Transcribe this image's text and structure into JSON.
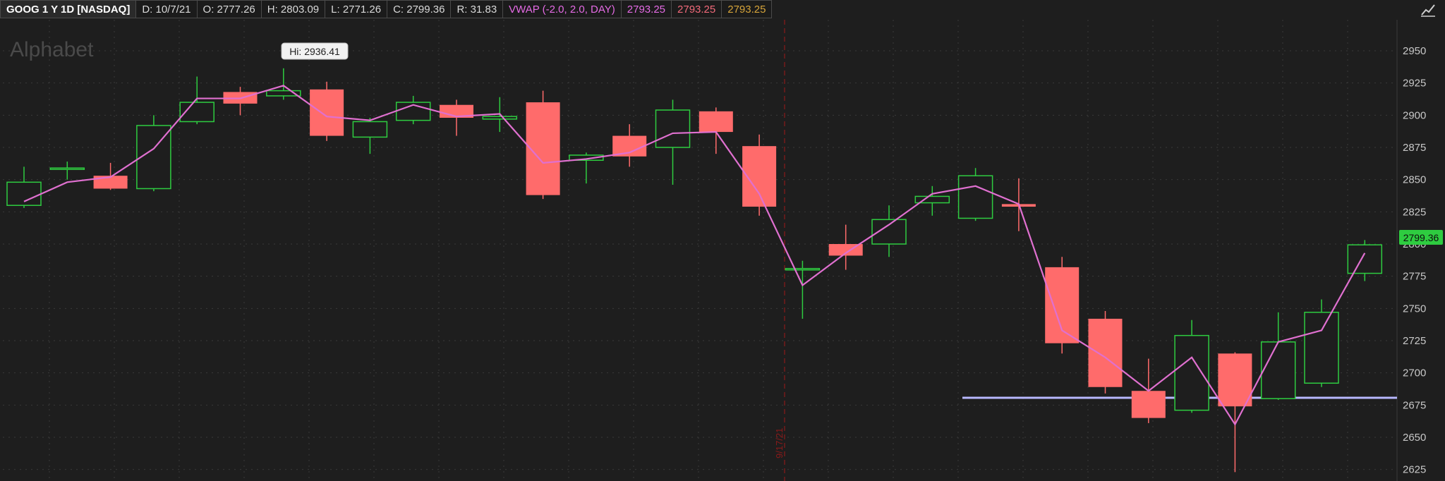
{
  "header": {
    "symbol": "GOOG 1 Y 1D [NASDAQ]",
    "date": "D: 10/7/21",
    "open": "O: 2777.26",
    "high": "H: 2803.09",
    "low": "L: 2771.26",
    "close": "C: 2799.36",
    "range": "R: 31.83",
    "vwap_label": "VWAP (-2.0, 2.0, DAY)",
    "vwap_values": [
      "2793.25",
      "2793.25",
      "2793.25"
    ]
  },
  "watermark": "Alphabet",
  "hi_label": "Hi: 2936.41",
  "date_marker": "9/17/21",
  "last_price": "2799.36",
  "colors": {
    "background": "#1e1e1e",
    "up": "#2ecc40",
    "down": "#ff6b6b",
    "vwap": "#e070d0",
    "support": "#b8b8ff",
    "last_price_bg": "#2ecc40"
  },
  "chart_data": {
    "type": "candlestick",
    "y_ticks": [
      2625,
      2650,
      2675,
      2700,
      2725,
      2750,
      2775,
      2800,
      2825,
      2850,
      2875,
      2900,
      2925,
      2950
    ],
    "ylim": [
      2615,
      2970
    ],
    "candles": [
      {
        "o": 2830,
        "h": 2860,
        "l": 2828,
        "c": 2848
      },
      {
        "o": 2858,
        "h": 2864,
        "l": 2850,
        "c": 2859
      },
      {
        "o": 2853,
        "h": 2863,
        "l": 2842,
        "c": 2843
      },
      {
        "o": 2843,
        "h": 2900,
        "l": 2841,
        "c": 2892
      },
      {
        "o": 2895,
        "h": 2930,
        "l": 2893,
        "c": 2910
      },
      {
        "o": 2918,
        "h": 2922,
        "l": 2900,
        "c": 2909
      },
      {
        "o": 2915,
        "h": 2936.41,
        "l": 2912,
        "c": 2919
      },
      {
        "o": 2920,
        "h": 2926,
        "l": 2880,
        "c": 2884
      },
      {
        "o": 2883,
        "h": 2898,
        "l": 2870,
        "c": 2895
      },
      {
        "o": 2896,
        "h": 2915,
        "l": 2893,
        "c": 2910
      },
      {
        "o": 2908,
        "h": 2912,
        "l": 2884,
        "c": 2898
      },
      {
        "o": 2897,
        "h": 2914,
        "l": 2887,
        "c": 2899
      },
      {
        "o": 2910,
        "h": 2919,
        "l": 2835,
        "c": 2838
      },
      {
        "o": 2865,
        "h": 2871,
        "l": 2847,
        "c": 2869
      },
      {
        "o": 2884,
        "h": 2893,
        "l": 2860,
        "c": 2868
      },
      {
        "o": 2875,
        "h": 2912,
        "l": 2846,
        "c": 2904
      },
      {
        "o": 2903,
        "h": 2906,
        "l": 2870,
        "c": 2887
      },
      {
        "o": 2876,
        "h": 2885,
        "l": 2822,
        "c": 2829
      },
      {
        "o": 2780,
        "h": 2787,
        "l": 2742,
        "c": 2781
      },
      {
        "o": 2800,
        "h": 2815,
        "l": 2780,
        "c": 2791
      },
      {
        "o": 2800,
        "h": 2830,
        "l": 2790,
        "c": 2819
      },
      {
        "o": 2832,
        "h": 2845,
        "l": 2822,
        "c": 2837
      },
      {
        "o": 2820,
        "h": 2859,
        "l": 2818,
        "c": 2853
      },
      {
        "o": 2831,
        "h": 2851,
        "l": 2810,
        "c": 2829
      },
      {
        "o": 2782,
        "h": 2790,
        "l": 2715,
        "c": 2723
      },
      {
        "o": 2742,
        "h": 2748,
        "l": 2684,
        "c": 2689
      },
      {
        "o": 2686,
        "h": 2711,
        "l": 2661,
        "c": 2665
      },
      {
        "o": 2671,
        "h": 2741,
        "l": 2669,
        "c": 2729
      },
      {
        "o": 2715,
        "h": 2716,
        "l": 2623,
        "c": 2674
      },
      {
        "o": 2680,
        "h": 2747,
        "l": 2679,
        "c": 2724
      },
      {
        "o": 2692,
        "h": 2757,
        "l": 2689,
        "c": 2747
      },
      {
        "o": 2777.26,
        "h": 2803.09,
        "l": 2771.26,
        "c": 2799.36
      }
    ],
    "vwap": [
      2833,
      2848,
      2852,
      2874,
      2913,
      2913,
      2923,
      2899,
      2896,
      2908,
      2899,
      2901,
      2863,
      2866,
      2871,
      2886,
      2887,
      2839,
      2768,
      2793,
      2815,
      2839,
      2845,
      2831,
      2733,
      2712,
      2686,
      2712,
      2660,
      2724,
      2733,
      2793
    ]
  }
}
